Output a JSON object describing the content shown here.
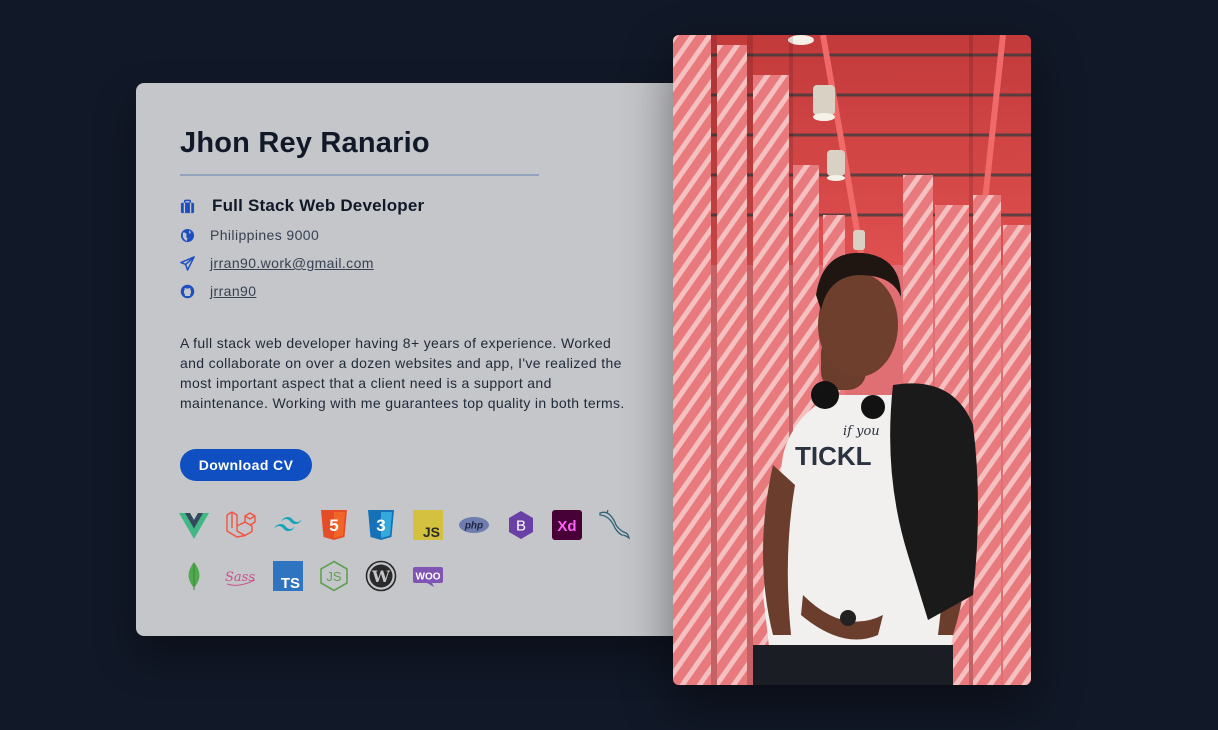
{
  "profile": {
    "name": "Jhon Rey Ranario",
    "role": "Full Stack Web Developer",
    "location": "Philippines 9000",
    "email": "jrran90.work@gmail.com",
    "github": "jrran90",
    "bio": "A full stack web developer having 8+ years of experience. Worked and collaborate on over a dozen websites and app, I've realized the most important aspect that a client need is a support and maintenance. Working with me guarantees top quality in both terms.",
    "download_label": "Download CV"
  },
  "icons": {
    "role": "briefcase-icon",
    "location": "globe-icon",
    "email": "paper-plane-icon",
    "github": "github-icon"
  },
  "tech_stack": {
    "row1": [
      "vue",
      "laravel",
      "tailwind",
      "html5",
      "css3",
      "javascript",
      "php",
      "bootstrap",
      "adobe-xd",
      "mysql"
    ],
    "row2": [
      "mongodb",
      "sass",
      "typescript",
      "nodejs",
      "wordpress",
      "woocommerce"
    ],
    "labels": {
      "html5": "5",
      "css3": "3",
      "javascript": "JS",
      "php": "php",
      "bootstrap": "B",
      "adobe-xd": "Xd",
      "sass": "Sass",
      "typescript": "TS",
      "nodejs": "JS",
      "wordpress": "W",
      "woocommerce": "WOO"
    }
  },
  "colors": {
    "page_background": "#111827",
    "card_background": "#c5c6ca",
    "accent": "#0f4fc2",
    "text_dark": "#111827"
  },
  "photo": {
    "shirt_text_1": "TICKL",
    "shirt_text_2": "if you"
  }
}
